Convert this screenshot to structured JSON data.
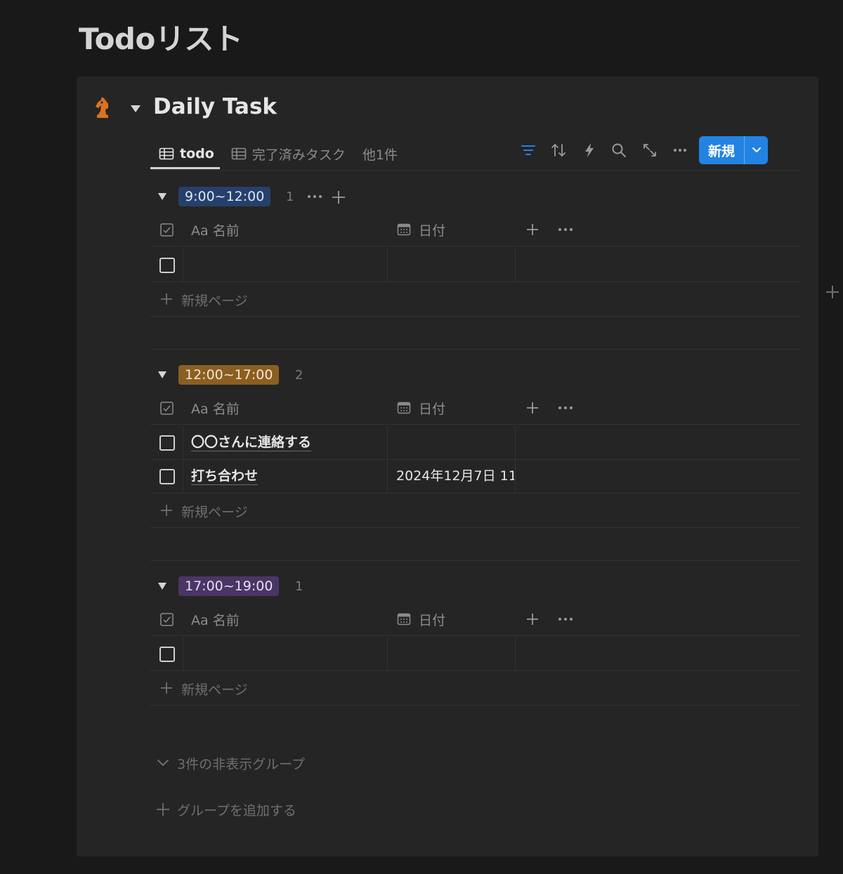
{
  "page": {
    "title": "Todoリスト"
  },
  "database": {
    "title": "Daily Task",
    "icon": "chess-knight-icon"
  },
  "tabs": [
    {
      "label": "todo",
      "icon": "table-icon",
      "active": true
    },
    {
      "label": "完了済みタスク",
      "icon": "table-icon",
      "active": false
    },
    {
      "label": "他1件",
      "active": false
    }
  ],
  "toolbar": {
    "icons": [
      "filter-icon",
      "sort-icon",
      "automation-icon",
      "search-icon",
      "expand-icon",
      "more-icon"
    ],
    "new_label": "新規",
    "accent": "#2383e2"
  },
  "columns": {
    "name_prefix": "Aa",
    "name": "名前",
    "date": "日付"
  },
  "groups": [
    {
      "label": "9:00~12:00",
      "count": "1",
      "badge_bg": "#27406b",
      "badge_fg": "#dbe7fa",
      "rows": [
        {
          "name": "",
          "date": ""
        }
      ]
    },
    {
      "label": "12:00~17:00",
      "count": "2",
      "badge_bg": "#8b5e22",
      "badge_fg": "#f7e6cf",
      "rows": [
        {
          "name": "〇〇さんに連絡する",
          "date": ""
        },
        {
          "name": "打ち合わせ",
          "date": "2024年12月7日 11"
        }
      ]
    },
    {
      "label": "17:00~19:00",
      "count": "1",
      "badge_bg": "#4b3565",
      "badge_fg": "#eadcf7",
      "rows": [
        {
          "name": "",
          "date": ""
        }
      ]
    }
  ],
  "new_page_label": "新規ページ",
  "hidden_groups_label": "3件の非表示グループ",
  "add_group_label": "グループを追加する"
}
